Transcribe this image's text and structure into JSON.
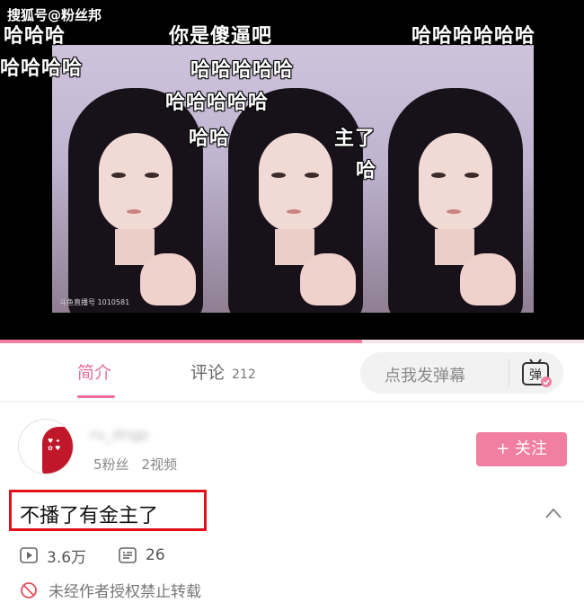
{
  "source_label": "搜狐号@粉丝邦",
  "video": {
    "watermark": "斗鱼直播号 1010581",
    "progress": 0.62,
    "danmu": [
      {
        "text": "哈哈哈"
      },
      {
        "text": "哈哈哈哈"
      },
      {
        "text": "你是傻逼吧"
      },
      {
        "text": "哈哈哈哈哈哈"
      },
      {
        "text": "哈哈哈哈哈"
      },
      {
        "text": "哈哈哈哈哈"
      },
      {
        "text": "哈哈"
      },
      {
        "text": "主了"
      },
      {
        "text": "哈"
      }
    ]
  },
  "tabs": [
    {
      "label": "简介",
      "active": true
    },
    {
      "label": "评论",
      "count": "212",
      "active": false
    }
  ],
  "danmu_input": {
    "placeholder": "点我发弹幕",
    "icon": "danmu-toggle-icon",
    "icon_text": "弹"
  },
  "uploader": {
    "name": "ru_dngp",
    "fans": "5粉丝",
    "videos": "2视频",
    "follow_label": "+ 关注"
  },
  "video_info": {
    "title": "不播了有金主了",
    "plays": "3.6万",
    "danmu_count": "26",
    "notice": "未经作者授权禁止转载"
  },
  "colors": {
    "accent": "#f07fa1",
    "highlight_border": "#e0101a"
  }
}
